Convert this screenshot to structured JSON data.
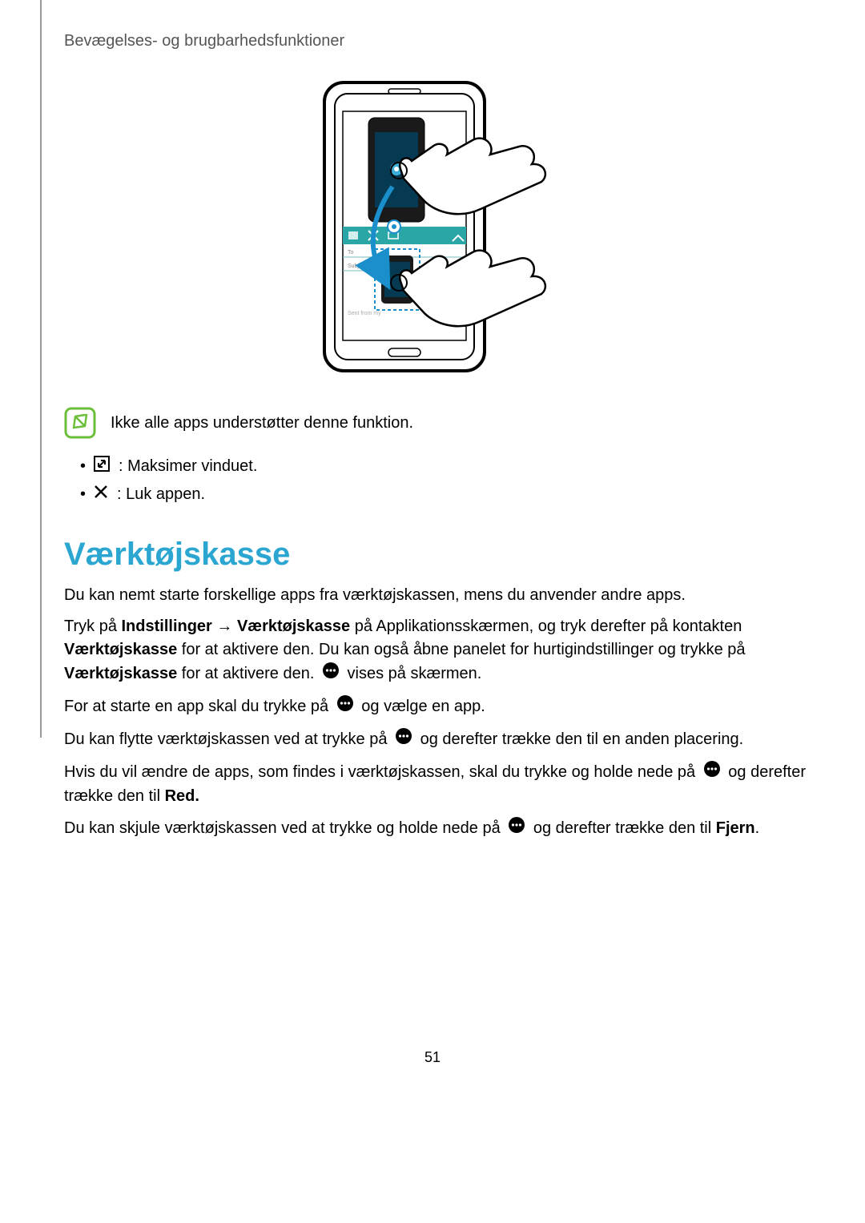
{
  "header": {
    "section": "Bevægelses- og brugbarhedsfunktioner"
  },
  "note": {
    "text": "Ikke alle apps understøtter denne funktion."
  },
  "iconList": {
    "item1": ": Maksimer vinduet.",
    "item2": ": Luk appen."
  },
  "main": {
    "title": "Værktøjskasse",
    "p1": "Du kan nemt starte forskellige apps fra værktøjskassen, mens du anvender andre apps.",
    "p2_a": "Tryk på ",
    "p2_b1": "Indstillinger",
    "p2_arrow": " → ",
    "p2_b2": "Værktøjskasse",
    "p2_c": " på Applikationsskærmen, og tryk derefter på kontakten ",
    "p2_b3": "Værktøjskasse",
    "p2_d": " for at aktivere den. Du kan også åbne panelet for hurtigindstillinger og trykke på ",
    "p2_b4": "Værktøjskasse",
    "p2_e": " for at aktivere den. ",
    "p2_f": " vises på skærmen.",
    "p3_a": "For at starte en app skal du trykke på ",
    "p3_b": " og vælge en app.",
    "p4_a": "Du kan flytte værktøjskassen ved at trykke på ",
    "p4_b": " og derefter trække den til en anden placering.",
    "p5_a": "Hvis du vil ændre de apps, som findes i værktøjskassen, skal du trykke og holde nede på ",
    "p5_b": " og derefter trække den til ",
    "p5_b2": "Red.",
    "p6_a": "Du kan skjule værktøjskassen ved at trykke og holde nede på ",
    "p6_b": " og derefter trække den til ",
    "p6_b2": "Fjern",
    "p6_c": "."
  },
  "pageNumber": "51"
}
